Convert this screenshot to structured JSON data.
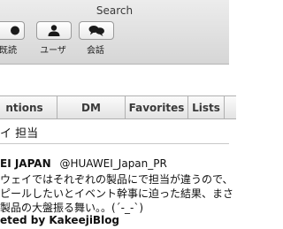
{
  "window": {
    "title": "Search"
  },
  "toolbar": {
    "buttons": [
      {
        "label": "既読",
        "icon": "read-icon"
      },
      {
        "label": "ユーザ",
        "icon": "user-icon"
      },
      {
        "label": "会話",
        "icon": "conversation-icon"
      }
    ]
  },
  "tabs": [
    {
      "label": "ntions"
    },
    {
      "label": "DM"
    },
    {
      "label": "Favorites"
    },
    {
      "label": "Lists"
    }
  ],
  "search": {
    "query": "イ 担当"
  },
  "tweet": {
    "author_name": "EI JAPAN",
    "author_handle": "@HUAWEI_Japan_PR",
    "lines": [
      "ウェイではそれぞれの製品にで担当が違うので、",
      "ピールしたいとイベント幹事に迫った結果、まさ",
      "製品の大盤振る舞い。。(´-_-`)"
    ],
    "retweeted_by": "eted by KakeejiBlog"
  }
}
